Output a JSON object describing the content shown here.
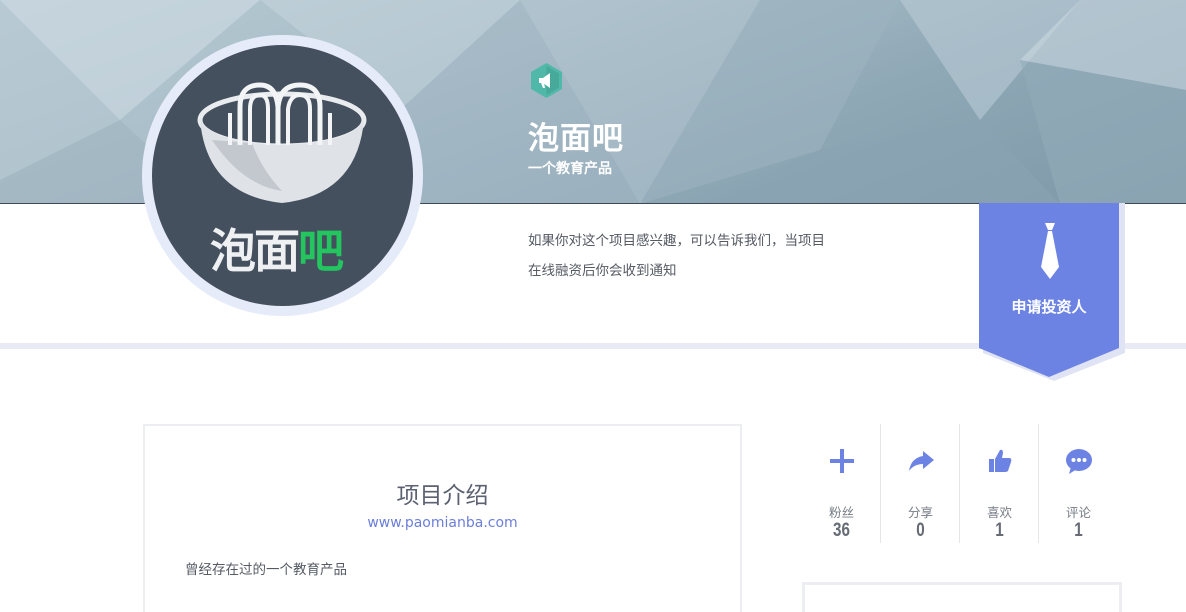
{
  "project": {
    "name": "泡面吧",
    "tagline": "一个教育产品",
    "description": "如果你对这个项目感兴趣，可以告诉我们，当项目在线融资后你会收到通知",
    "logo_text_left": "泡面",
    "logo_text_right": "吧",
    "badge_icon": "megaphone-icon"
  },
  "apply_button": {
    "label": "申请投资人",
    "icon": "tie-icon",
    "color": "#6c83e3"
  },
  "intro": {
    "title": "项目介绍",
    "website": "www.paomianba.com",
    "text": "曾经存在过的一个教育产品"
  },
  "stats": [
    {
      "icon": "plus-icon",
      "label": "粉丝",
      "count": "36"
    },
    {
      "icon": "share-icon",
      "label": "分享",
      "count": "0"
    },
    {
      "icon": "thumbs-up-icon",
      "label": "喜欢",
      "count": "1"
    },
    {
      "icon": "comment-icon",
      "label": "评论",
      "count": "1"
    }
  ],
  "colors": {
    "accent": "#6c83e3",
    "badge": "#4fb8a8",
    "logo_green": "#22c55e",
    "avatar_bg": "#45505f"
  }
}
